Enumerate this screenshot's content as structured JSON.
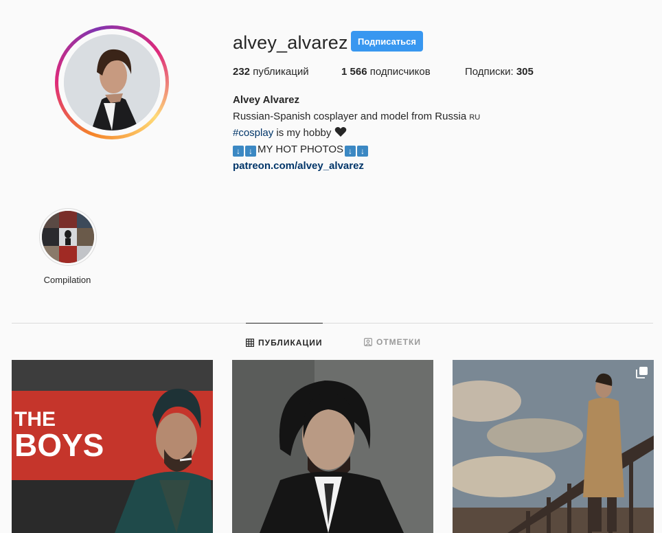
{
  "profile": {
    "username": "alvey_alvarez",
    "follow_label": "Подписаться",
    "stats": {
      "posts_count": "232",
      "posts_label": "публикаций",
      "followers_count": "1 566",
      "followers_label": "подписчиков",
      "following_label": "Подписки:",
      "following_count": "305"
    },
    "full_name": "Alvey Alvarez",
    "bio": {
      "line1": "Russian-Spanish cosplayer and model from Russia",
      "line1_flag": "RU",
      "hashtag": "#cosplay",
      "line2_rest": " is my hobby",
      "line3_text": "MY HOT PHOTOS",
      "arrow_glyph": "↓"
    },
    "link": "patreon.com/alvey_alvarez"
  },
  "highlights": [
    {
      "label": "Compilation"
    }
  ],
  "tabs": [
    {
      "label": "ПУБЛИКАЦИИ",
      "icon": "grid-icon",
      "active": true
    },
    {
      "label": "ОТМЕТКИ",
      "icon": "tagged-icon",
      "active": false
    }
  ],
  "posts": [
    {
      "overlay_text": "THE BOYS",
      "icon": "none"
    },
    {
      "icon": "none"
    },
    {
      "icon": "carousel-icon"
    }
  ],
  "colors": {
    "follow_button": "#3897f0",
    "link": "#003569",
    "text": "#262626",
    "muted": "#999999",
    "background": "#fafafa"
  }
}
